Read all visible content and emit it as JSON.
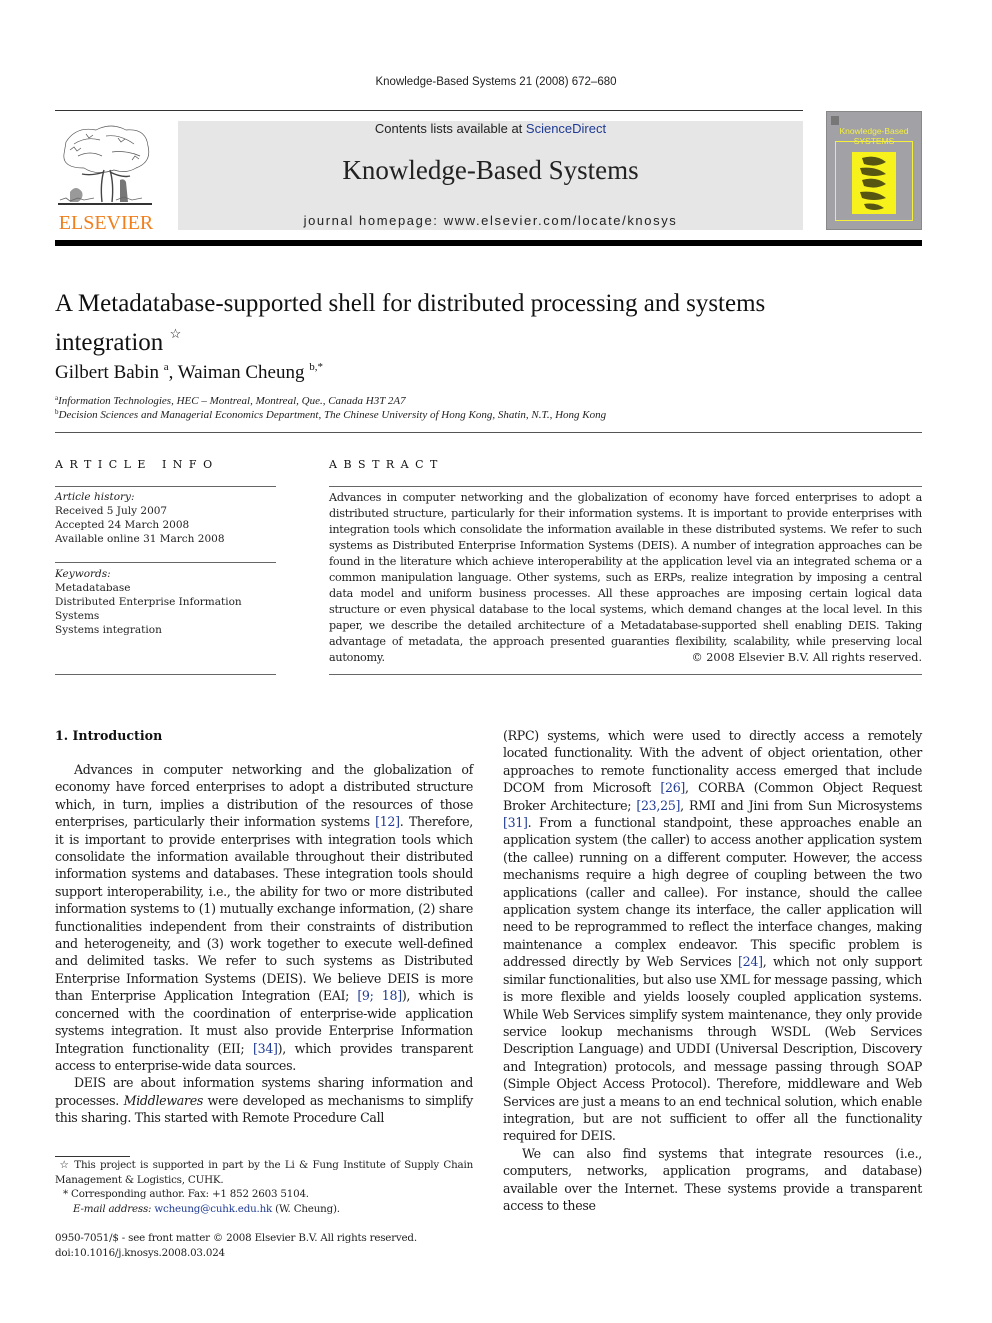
{
  "running_head": "Knowledge-Based Systems 21 (2008) 672–680",
  "masthead": {
    "publisher_logo_word": "ELSEVIER",
    "contents_prefix": "Contents lists available at ",
    "contents_link": "ScienceDirect",
    "journal_name": "Knowledge-Based Systems",
    "homepage": "journal homepage: www.elsevier.com/locate/knosys",
    "cover_title_line1": "Knowledge-Based",
    "cover_title_line2": "SYSTEMS",
    "colors": {
      "publisher_orange": "#f07f1c",
      "link_blue": "#1f3a93",
      "cover_gray": "#a2a2a6",
      "cover_yellow": "#f7f21c",
      "banner_gray": "#e6e6e6"
    }
  },
  "article": {
    "title": "A Metadatabase-supported shell for distributed processing and systems integration",
    "title_note_mark": "☆",
    "authors": [
      {
        "name": "Gilbert Babin",
        "marks": "a"
      },
      {
        "name": "Waiman Cheung",
        "marks": "b,*"
      }
    ],
    "author_separator": ", ",
    "affiliations": [
      {
        "mark": "a",
        "text": "Information Technologies, HEC – Montreal, Montreal, Que., Canada H3T 2A7"
      },
      {
        "mark": "b",
        "text": "Decision Sciences and Managerial Economics Department, The Chinese University of Hong Kong, Shatin, N.T., Hong Kong"
      }
    ]
  },
  "article_info": {
    "heading": "ARTICLE INFO",
    "history_label": "Article history:",
    "history": [
      "Received 5 July 2007",
      "Accepted 24 March 2008",
      "Available online 31 March 2008"
    ],
    "keywords_label": "Keywords:",
    "keywords": [
      "Metadatabase",
      "Distributed Enterprise Information Systems",
      "Systems integration"
    ]
  },
  "abstract": {
    "heading": "ABSTRACT",
    "text": "Advances in computer networking and the globalization of economy have forced enterprises to adopt a distributed structure, particularly for their information systems. It is important to provide enterprises with integration tools which consolidate the information available in these distributed systems. We refer to such systems as Distributed Enterprise Information Systems (DEIS). A number of integration approaches can be found in the literature which achieve interoperability at the application level via an integrated schema or a common manipulation language. Other systems, such as ERPs, realize integration by imposing a central data model and uniform business processes. All these approaches are imposing certain logical data structure or even physical database to the local systems, which demand changes at the local level. In this paper, we describe the detailed architecture of a Metadatabase-supported shell enabling DEIS. Taking advantage of metadata, the approach presented guaranties flexibility, scalability, while preserving local autonomy.",
    "copyright": "© 2008 Elsevier B.V. All rights reserved."
  },
  "body": {
    "section_heading": "1.  Introduction",
    "left_p1": [
      "Advances in computer networking and the globalization of economy have forced enterprises to adopt a distributed structure which, in turn, implies a distribution of the resources of those enterprises, particularly their information systems ",
      "[12]",
      ". Therefore, it is important to provide enterprises with integration tools which consolidate the information available throughout their distributed information systems and databases. These integration tools should support interoperability, i.e., the ability for two or more distributed information systems to (1) mutually exchange information, (2) share functionalities independent from their constraints of distribution and heterogeneity, and (3) work together to execute well-defined and delimited tasks. We refer to such systems as Distributed Enterprise Information Systems (DEIS). We believe DEIS is more than Enterprise Application Integration (EAI; ",
      "[9; 18]",
      "), which is concerned with the coordination of enterprise-wide application systems integration. It must also provide Enterprise Information Integration functionality (EII; ",
      "[34]",
      "), which provides transparent access to enterprise-wide data sources."
    ],
    "left_p2": [
      "DEIS are about information systems sharing information and processes. ",
      "Middlewares",
      " were developed as mechanisms to simplify this sharing. This started with Remote Procedure Call"
    ],
    "right_p1": [
      "(RPC) systems, which were used to directly access a remotely located functionality. With the advent of object orientation, other approaches to remote functionality access emerged that include DCOM from Microsoft ",
      "[26]",
      ", CORBA (Common Object Request Broker Architecture; ",
      "[23,25]",
      ", RMI and Jini from Sun Microsystems ",
      "[31]",
      ". From a functional standpoint, these approaches enable an application system (the caller) to access another application system (the callee) running on a different computer. However, the access mechanisms require a high degree of coupling between the two applications (caller and callee). For instance, should the callee application system change its interface, the caller application will need to be reprogrammed to reflect the interface changes, making maintenance a complex endeavor. This specific problem is addressed directly by Web Services ",
      "[24]",
      ", which not only support similar functionalities, but also use XML for message passing, which is more flexible and yields loosely coupled application systems. While Web Services simplify system maintenance, they only provide service lookup mechanisms through WSDL (Web Services Description Language) and UDDI (Universal Description, Discovery and Integration) protocols, and message passing through SOAP (Simple Object Access Protocol). Therefore, middleware and Web Services are just a means to an end technical solution, which enable integration, but are not sufficient to offer all the functionality required for DEIS."
    ],
    "right_p2": "We can also find systems that integrate resources (i.e., computers, networks, application programs, and database) available over the Internet. These systems provide a transparent access to these"
  },
  "footnotes": {
    "star_mark": "☆",
    "star_text": " This project is supported in part by the Li & Fung Institute of Supply Chain Management & Logistics, CUHK.",
    "corr_mark": "*",
    "corr_text": " Corresponding author. Fax: +1 852 2603 5104.",
    "email_label": "E-mail address: ",
    "email": "wcheung@cuhk.edu.hk",
    "email_suffix": " (W. Cheung)."
  },
  "front_matter": {
    "issn_line": "0950-7051/$ - see front matter © 2008 Elsevier B.V. All rights reserved.",
    "doi": "doi:10.1016/j.knosys.2008.03.024"
  }
}
